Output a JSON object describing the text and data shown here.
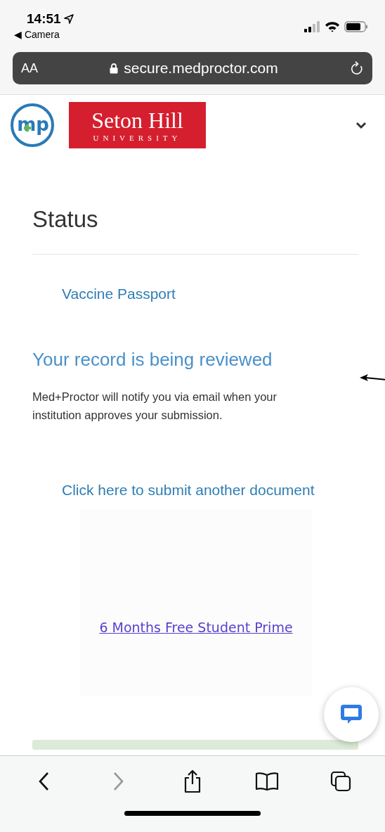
{
  "status_bar": {
    "time": "14:51",
    "back_app": "◀ Camera"
  },
  "address_bar": {
    "text_size": "AA",
    "url": "secure.medproctor.com"
  },
  "header": {
    "logo_text": "mp",
    "university": "Seton Hill",
    "university_sub": "UNIVERSITY",
    "menu_expanded": false
  },
  "page": {
    "title": "Status",
    "tab": "Vaccine Passport",
    "heading": "Your record is being reviewed",
    "message": "Med+Proctor will notify you via email when your institution approves your submission.",
    "submit_link": "Click here to submit another document",
    "promo_link": "6 Months Free Student Prime"
  },
  "toolbar": [
    {
      "kind": "back",
      "disabled": false
    },
    {
      "kind": "forward",
      "disabled": true
    },
    {
      "kind": "share",
      "disabled": false
    },
    {
      "kind": "bookmarks",
      "disabled": false
    },
    {
      "kind": "tabs",
      "disabled": false
    }
  ]
}
